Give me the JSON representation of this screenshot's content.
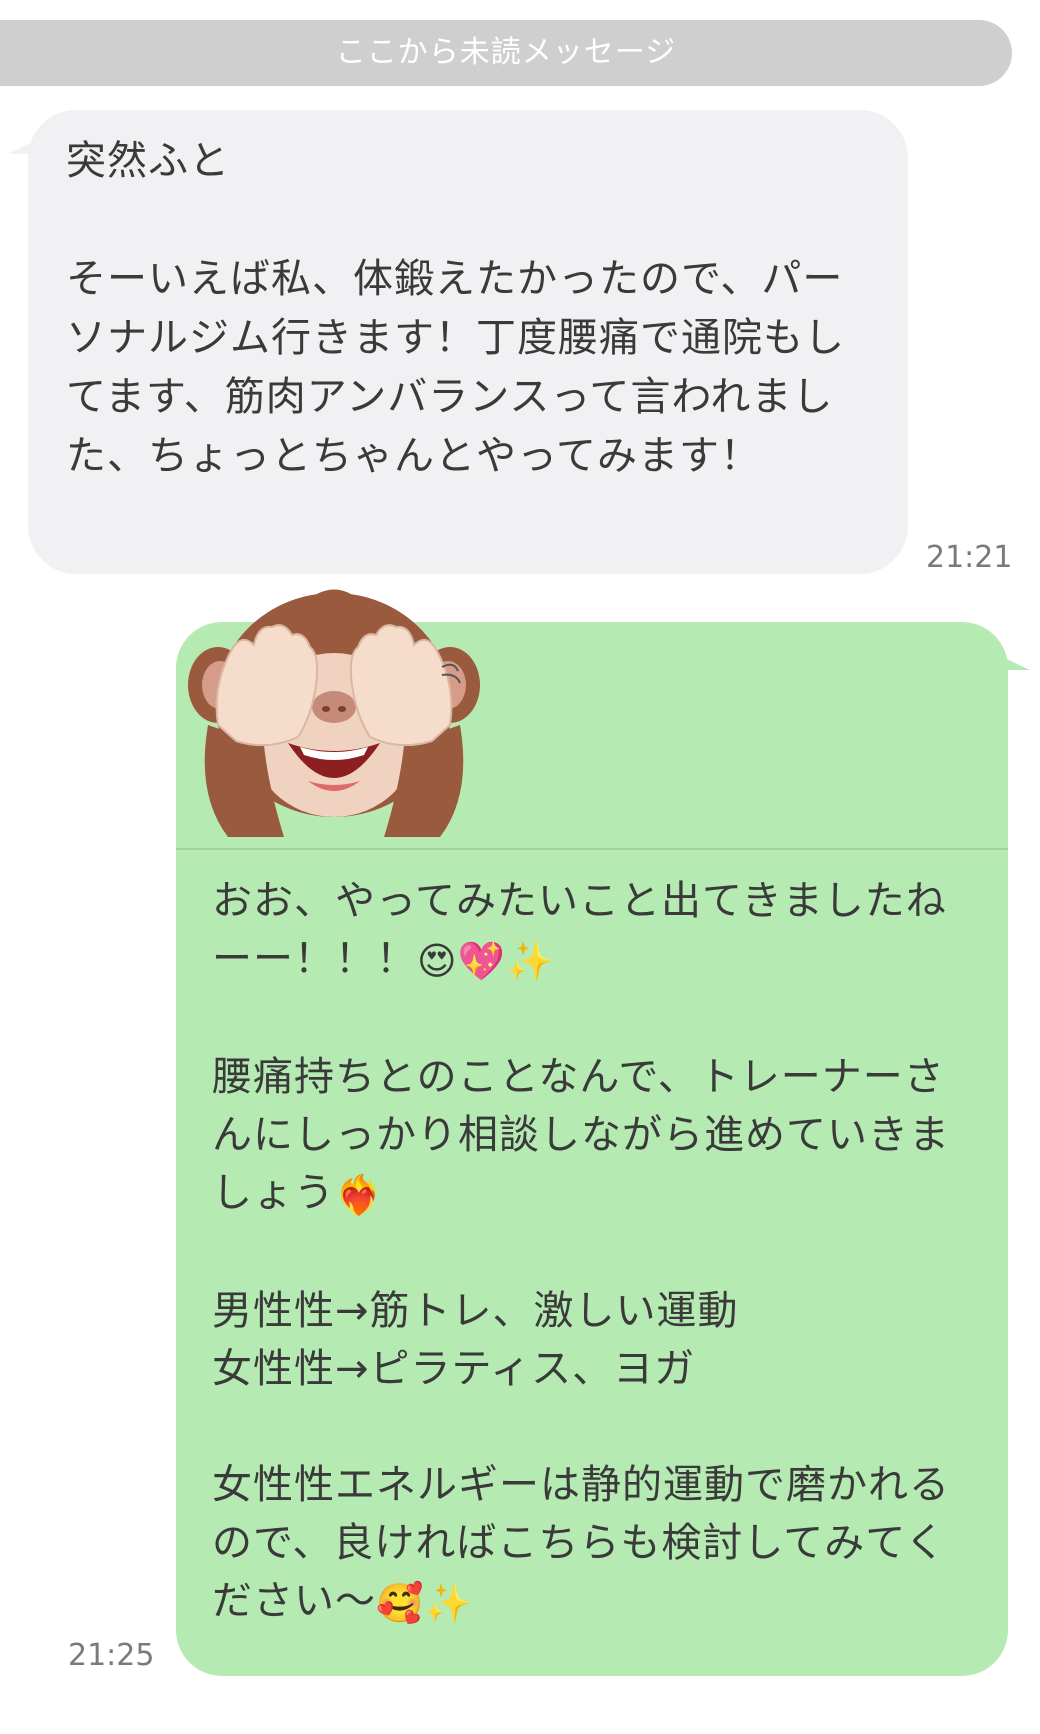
{
  "unread_divider": {
    "label": "ここから未読メッセージ"
  },
  "incoming": {
    "text": "突然ふと\n\nそーいえば私、体鍛えたかったので、パーソナルジム行きます！丁度腰痛で通院もしてます、筋肉アンバランスって言われました、ちょっとちゃんとやってみます！",
    "time": "21:21"
  },
  "outgoing": {
    "sticker_icon": "see-no-evil-monkey-icon",
    "para1": "おお、やってみたいこと出てきましたねーー！！！",
    "para1_emojis": [
      "😍",
      "💖",
      "✨"
    ],
    "para2": "腰痛持ちとのことなんで、トレーナーさんにしっかり相談しながら進めていきましょう",
    "para2_emoji": "❤️‍🔥",
    "para3_line1": "男性性→筋トレ、激しい運動",
    "para3_line2": "女性性→ピラティス、ヨガ",
    "para4": "女性性エネルギーは静的運動で磨かれるので、良ければこちらも検討してみてください〜",
    "para4_emojis": [
      "🥰",
      "✨"
    ],
    "time": "21:25"
  },
  "colors": {
    "incoming_bubble": "#f1f1f3",
    "outgoing_bubble": "#b6eab3",
    "unread_bar": "#cfcfcf"
  }
}
